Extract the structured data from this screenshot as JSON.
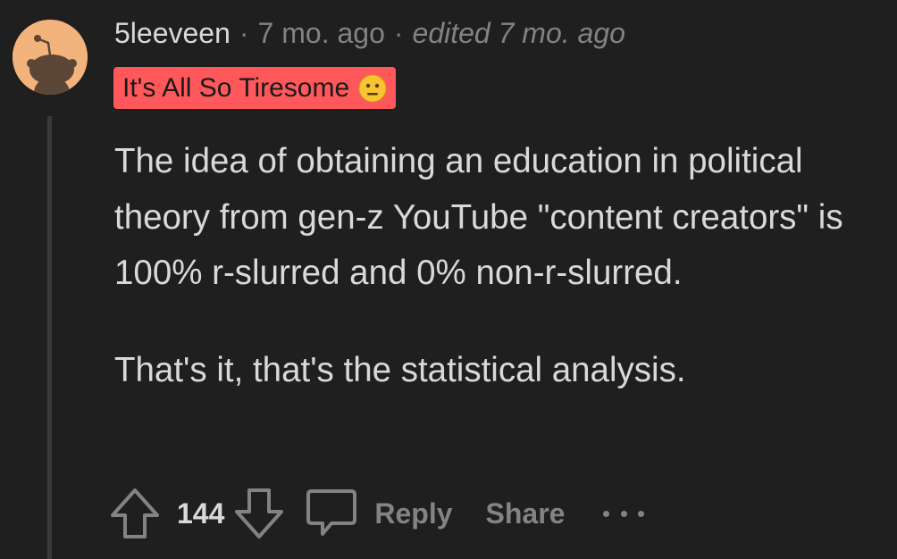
{
  "comment": {
    "author": "5leeveen",
    "separator": "·",
    "time": "7 mo. ago",
    "edited": "edited 7 mo. ago",
    "flair": {
      "text": "It's All So Tiresome",
      "emoji": "neutral-face-emoji",
      "background": "#ff585b"
    },
    "avatar_icon": "snoo-avatar-icon",
    "body": [
      "The idea of obtaining an education in political theory from gen-z YouTube \"content creators\" is 100% r-slurred and 0% non-r-slurred.",
      "That's it, that's the statistical analysis."
    ]
  },
  "actions": {
    "score": "144",
    "reply_label": "Reply",
    "share_label": "Share",
    "upvote_icon": "arrow-up-icon",
    "downvote_icon": "arrow-down-icon",
    "reply_icon": "speech-bubble-icon",
    "more_icon": "ellipsis-icon"
  },
  "colors": {
    "background": "#1f1f1f",
    "text": "#d7dadc",
    "muted": "#818384",
    "avatar_bg": "#f3b37d"
  }
}
